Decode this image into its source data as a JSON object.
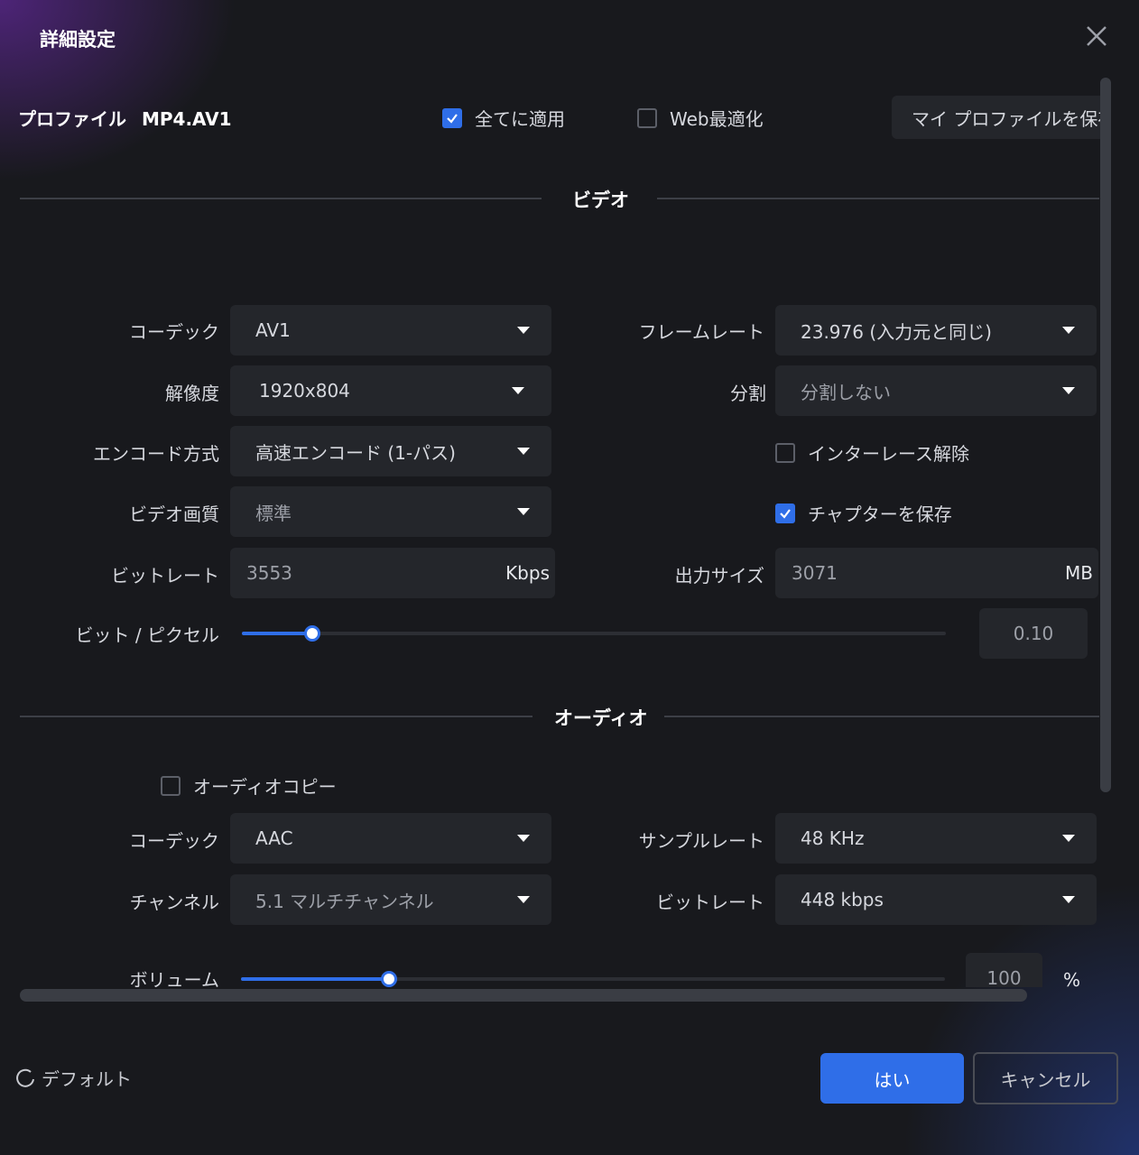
{
  "dialog": {
    "title": "詳細設定"
  },
  "profile": {
    "label": "プロファイル",
    "name": "MP4.AV1",
    "apply_all": {
      "label": "全てに適用",
      "checked": true
    },
    "web_optimize": {
      "label": "Web最適化",
      "checked": false
    },
    "save_profile_label": "マイ プロファイルを保存"
  },
  "video": {
    "section_title": "ビデオ",
    "codec": {
      "label": "コーデック",
      "value": "AV1"
    },
    "resolution": {
      "label": "解像度",
      "value": "1920x804"
    },
    "encode_mode": {
      "label": "エンコード方式",
      "value": "高速エンコード (1-パス)"
    },
    "quality": {
      "label": "ビデオ画質",
      "value": "標準"
    },
    "bitrate": {
      "label": "ビットレート",
      "value": "3553",
      "unit": "Kbps"
    },
    "bits_per_pixel": {
      "label": "ビット / ピクセル",
      "value": "0.10",
      "fraction": 0.1
    },
    "frame_rate": {
      "label": "フレームレート",
      "value": "23.976 (入力元と同じ)"
    },
    "split": {
      "label": "分割",
      "value": "分割しない"
    },
    "deinterlace": {
      "label": "インターレース解除",
      "checked": false
    },
    "keep_chapters": {
      "label": "チャプターを保存",
      "checked": true
    },
    "output_size": {
      "label": "出力サイズ",
      "value": "3071",
      "unit": "MB"
    }
  },
  "audio": {
    "section_title": "オーディオ",
    "audio_copy": {
      "label": "オーディオコピー",
      "checked": false
    },
    "codec": {
      "label": "コーデック",
      "value": "AAC"
    },
    "channel": {
      "label": "チャンネル",
      "value": "5.1 マルチチャンネル"
    },
    "sample_rate": {
      "label": "サンプルレート",
      "value": "48 KHz"
    },
    "bitrate": {
      "label": "ビットレート",
      "value": "448 kbps"
    },
    "volume": {
      "label": "ボリューム",
      "value": "100",
      "unit": "%",
      "fraction": 0.21
    }
  },
  "footer": {
    "default_label": "デフォルト",
    "ok_label": "はい",
    "cancel_label": "キャンセル"
  },
  "colors": {
    "accent": "#2f6ee8",
    "background": "#18191d",
    "control": "#24262b"
  },
  "icons": {
    "close": "close-icon",
    "check": "check-icon",
    "caret": "caret-down-icon",
    "reset": "reset-icon"
  }
}
